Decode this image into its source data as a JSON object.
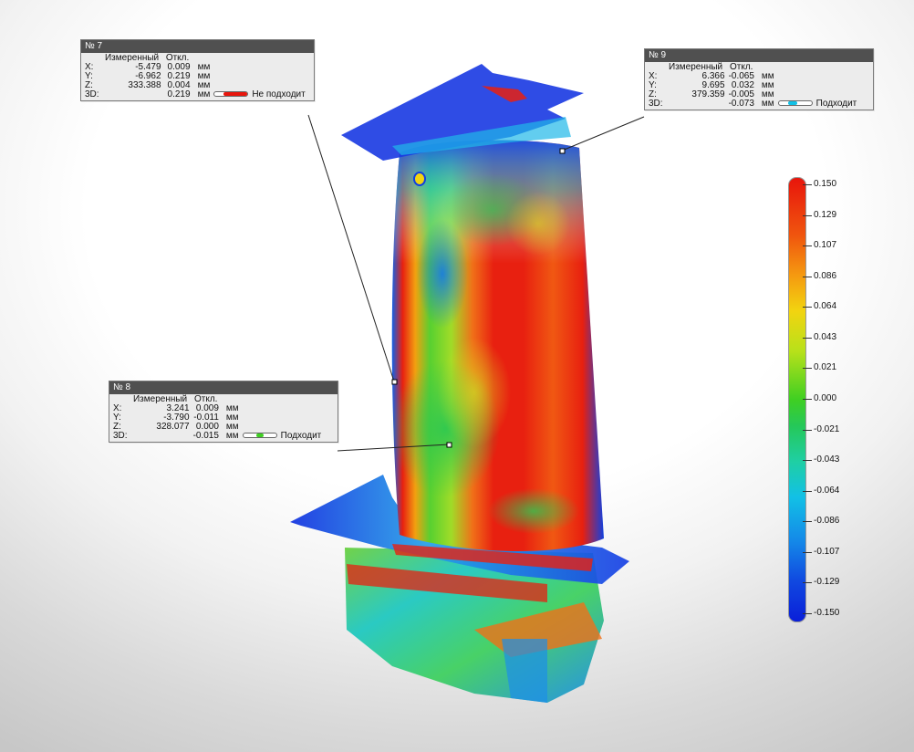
{
  "callouts": [
    {
      "id": "№ 7",
      "col_measured": "Измеренный",
      "col_dev": "Откл.",
      "rows": [
        {
          "axis": "X:",
          "measured": "-5.479",
          "dev": "0.009",
          "unit": "мм"
        },
        {
          "axis": "Y:",
          "measured": "-6.962",
          "dev": "0.219",
          "unit": "мм"
        },
        {
          "axis": "Z:",
          "measured": "333.388",
          "dev": "0.004",
          "unit": "мм"
        }
      ],
      "d3": {
        "axis": "3D:",
        "dev": "0.219",
        "unit": "мм",
        "status": "Не подходит"
      }
    },
    {
      "id": "№ 8",
      "col_measured": "Измеренный",
      "col_dev": "Откл.",
      "rows": [
        {
          "axis": "X:",
          "measured": "3.241",
          "dev": "0.009",
          "unit": "мм"
        },
        {
          "axis": "Y:",
          "measured": "-3.790",
          "dev": "-0.011",
          "unit": "мм"
        },
        {
          "axis": "Z:",
          "measured": "328.077",
          "dev": "0.000",
          "unit": "мм"
        }
      ],
      "d3": {
        "axis": "3D:",
        "dev": "-0.015",
        "unit": "мм",
        "status": "Подходит"
      }
    },
    {
      "id": "№ 9",
      "col_measured": "Измеренный",
      "col_dev": "Откл.",
      "rows": [
        {
          "axis": "X:",
          "measured": "6.366",
          "dev": "-0.065",
          "unit": "мм"
        },
        {
          "axis": "Y:",
          "measured": "9.695",
          "dev": "0.032",
          "unit": "мм"
        },
        {
          "axis": "Z:",
          "measured": "379.359",
          "dev": "-0.005",
          "unit": "мм"
        }
      ],
      "d3": {
        "axis": "3D:",
        "dev": "-0.073",
        "unit": "мм",
        "status": "Подходит"
      }
    }
  ],
  "legend": {
    "labels": [
      "0.150",
      "0.129",
      "0.107",
      "0.086",
      "0.064",
      "0.043",
      "0.021",
      "0.000",
      "-0.021",
      "-0.043",
      "-0.064",
      "-0.086",
      "-0.107",
      "-0.129",
      "-0.150"
    ],
    "colors": {
      "max": "#e8150c",
      "mid": "#3fcf22",
      "min": "#0a1fd9"
    }
  },
  "colors": {
    "fail": "#e8150c",
    "pass": "#3fcf22",
    "pass_blue": "#12c0e6",
    "header": "#505050"
  }
}
